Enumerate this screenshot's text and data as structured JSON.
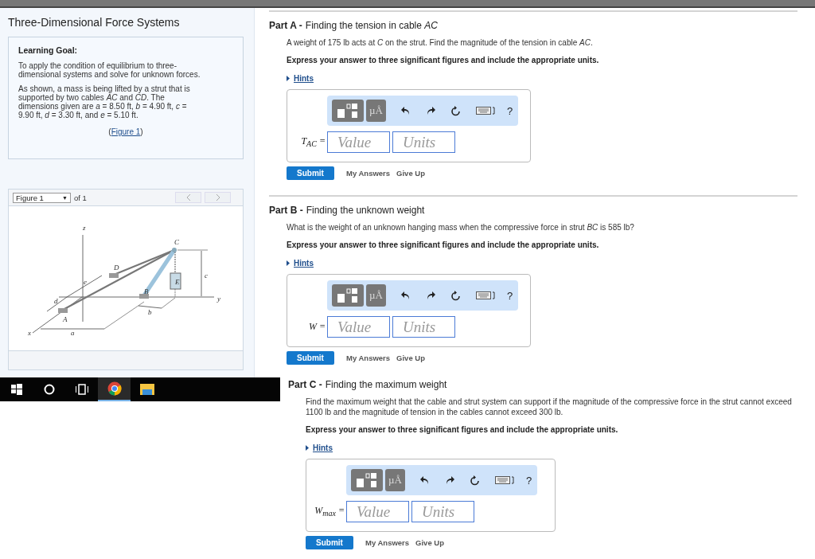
{
  "sidebar": {
    "title": "Three-Dimensional Force Systems",
    "learning_goal": {
      "heading": "Learning Goal:",
      "paragraphs": [
        "To apply the condition of equilibrium to three-dimensional systems and solve for unknown forces.",
        "As shown, a mass is being lifted by a strut that is supported by two cables *AC* and *CD*. The dimensions given are *a* = 8.50 ft, *b* = 4.90 ft, *c* = 9.90 ft, *d* = 3.30 ft, and *e* = 5.10 ft."
      ],
      "figure_link": {
        "open": "(",
        "label": "Figure 1",
        "close": ")"
      }
    },
    "figure_panel": {
      "select": "Figure 1",
      "caret": "▼",
      "count": "of 1",
      "labels": [
        "z",
        "C",
        "D",
        "c",
        "e",
        "E",
        "B",
        "d",
        "y",
        "b",
        "A",
        "x",
        "a"
      ]
    }
  },
  "taskbar": [
    {
      "kind": "start",
      "selected": false
    },
    {
      "kind": "search",
      "selected": false
    },
    {
      "kind": "taskview",
      "selected": false
    },
    {
      "kind": "browser",
      "selected": true
    },
    {
      "kind": "folder",
      "selected": false
    }
  ],
  "parts": [
    {
      "label": "Part A -",
      "title": "Finding the tension in cable *AC*",
      "question": "A weight of 175 lb acts at *C* on the strut. Find the magnitude of the tension in cable *AC*.",
      "instruction": "Express your answer to three significant figures and include the appropriate units.",
      "hints": "Hints",
      "units_button": "µÅ",
      "help": "?",
      "variable": "T$_{AC}$ =",
      "value_placeholder": "Value",
      "units_placeholder": "Units",
      "submit": "Submit",
      "my_answers": "My Answers",
      "give_up": "Give Up"
    },
    {
      "label": "Part B -",
      "title": "Finding the unknown weight",
      "question": "What is the weight of an unknown hanging mass when the compressive force in strut *BC* is 585 lb?",
      "instruction": "Express your answer to three significant figures and include the appropriate units.",
      "hints": "Hints",
      "units_button": "µÅ",
      "help": "?",
      "variable": "W =",
      "value_placeholder": "Value",
      "units_placeholder": "Units",
      "submit": "Submit",
      "my_answers": "My Answers",
      "give_up": "Give Up"
    },
    {
      "label": "Part C -",
      "title": "Finding the maximum weight",
      "question": "Find the maximum weight that the cable and strut system can support if the magnitude of the compressive force in the strut cannot exceed 1100 lb and the magnitude of tension in the cables cannot exceed 300 lb.",
      "instruction": "Express your answer to three significant figures and include the appropriate units.",
      "hints": "Hints",
      "units_button": "µÅ",
      "help": "?",
      "variable": "W$_{max}$ =",
      "value_placeholder": "Value",
      "units_placeholder": "Units",
      "submit": "Submit",
      "my_answers": "My Answers",
      "give_up": "Give Up"
    }
  ]
}
